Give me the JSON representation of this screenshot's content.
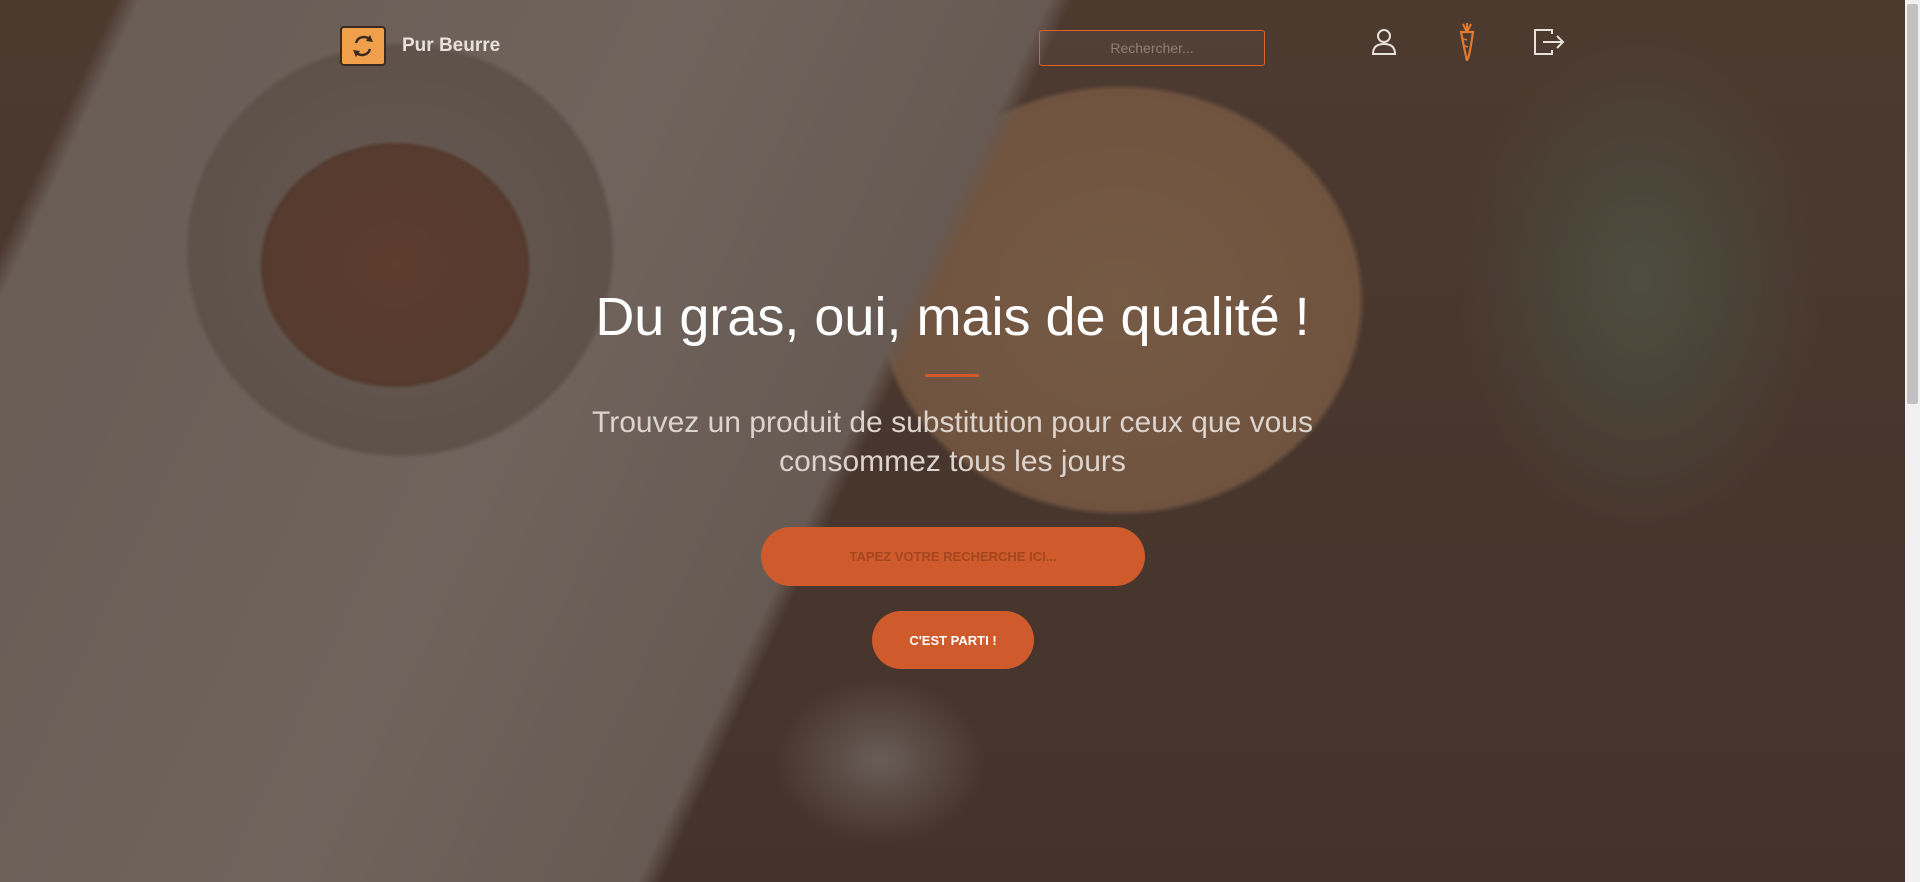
{
  "navbar": {
    "brand_name": "Pur Beurre",
    "search_placeholder": "Rechercher...",
    "icons": [
      "user-icon",
      "carrot-icon",
      "logout-icon"
    ]
  },
  "hero": {
    "title": "Du gras, oui, mais de qualité !",
    "subtitle": "Trouvez un produit de substitution pour ceux que vous consommez tous les jours",
    "search_placeholder": "Tapez votre recherche ici...",
    "submit_label": "C'EST PARTI !"
  },
  "colors": {
    "accent": "#cf5a2c",
    "logo": "#f0a04a",
    "text": "#ffffff"
  }
}
